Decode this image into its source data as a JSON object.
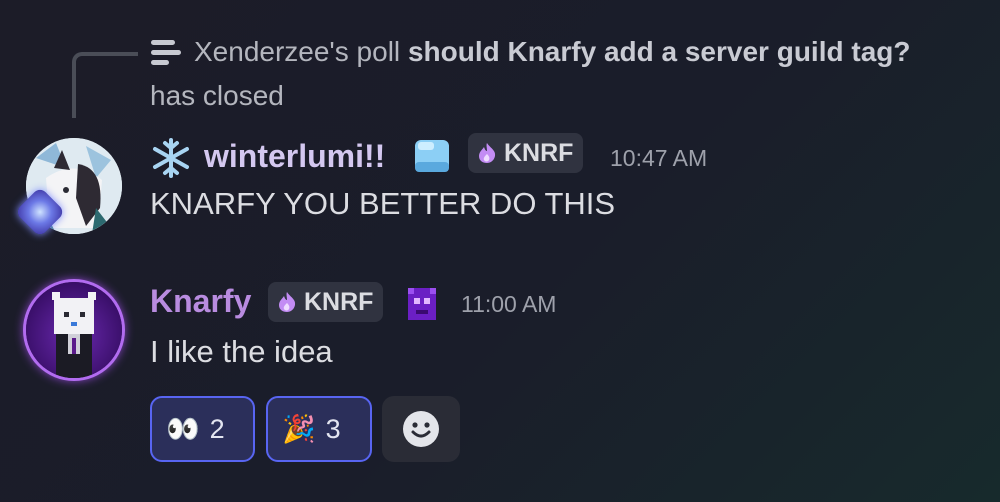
{
  "reply": {
    "prefix": "Xenderzee's poll",
    "poll_title": "should Knarfy add a server guild tag?",
    "suffix": "has closed"
  },
  "messages": [
    {
      "username": "winterlumi!!",
      "username_color": "#d4c8f0",
      "tag": "KNRF",
      "time": "10:47 AM",
      "text": "KNARFY YOU BETTER DO THIS"
    },
    {
      "username": "Knarfy",
      "username_color": "#b98ce0",
      "tag": "KNRF",
      "time": "11:00 AM",
      "text": "I like the idea"
    }
  ],
  "reactions": [
    {
      "emoji": "👀",
      "emoji_name": "eyes",
      "count": "2"
    },
    {
      "emoji": "🎉",
      "emoji_name": "party-popper",
      "count": "3"
    }
  ],
  "icons": {
    "poll": "poll-icon",
    "snowflake": "snowflake-icon",
    "ice_cube": "ice-cube-icon",
    "tag_badge": "flame-icon",
    "pixel_badge": "pixel-creature-icon",
    "add_reaction": "smiley-icon"
  },
  "colors": {
    "accent": "#5865f2",
    "tag_bg": "#303340"
  }
}
